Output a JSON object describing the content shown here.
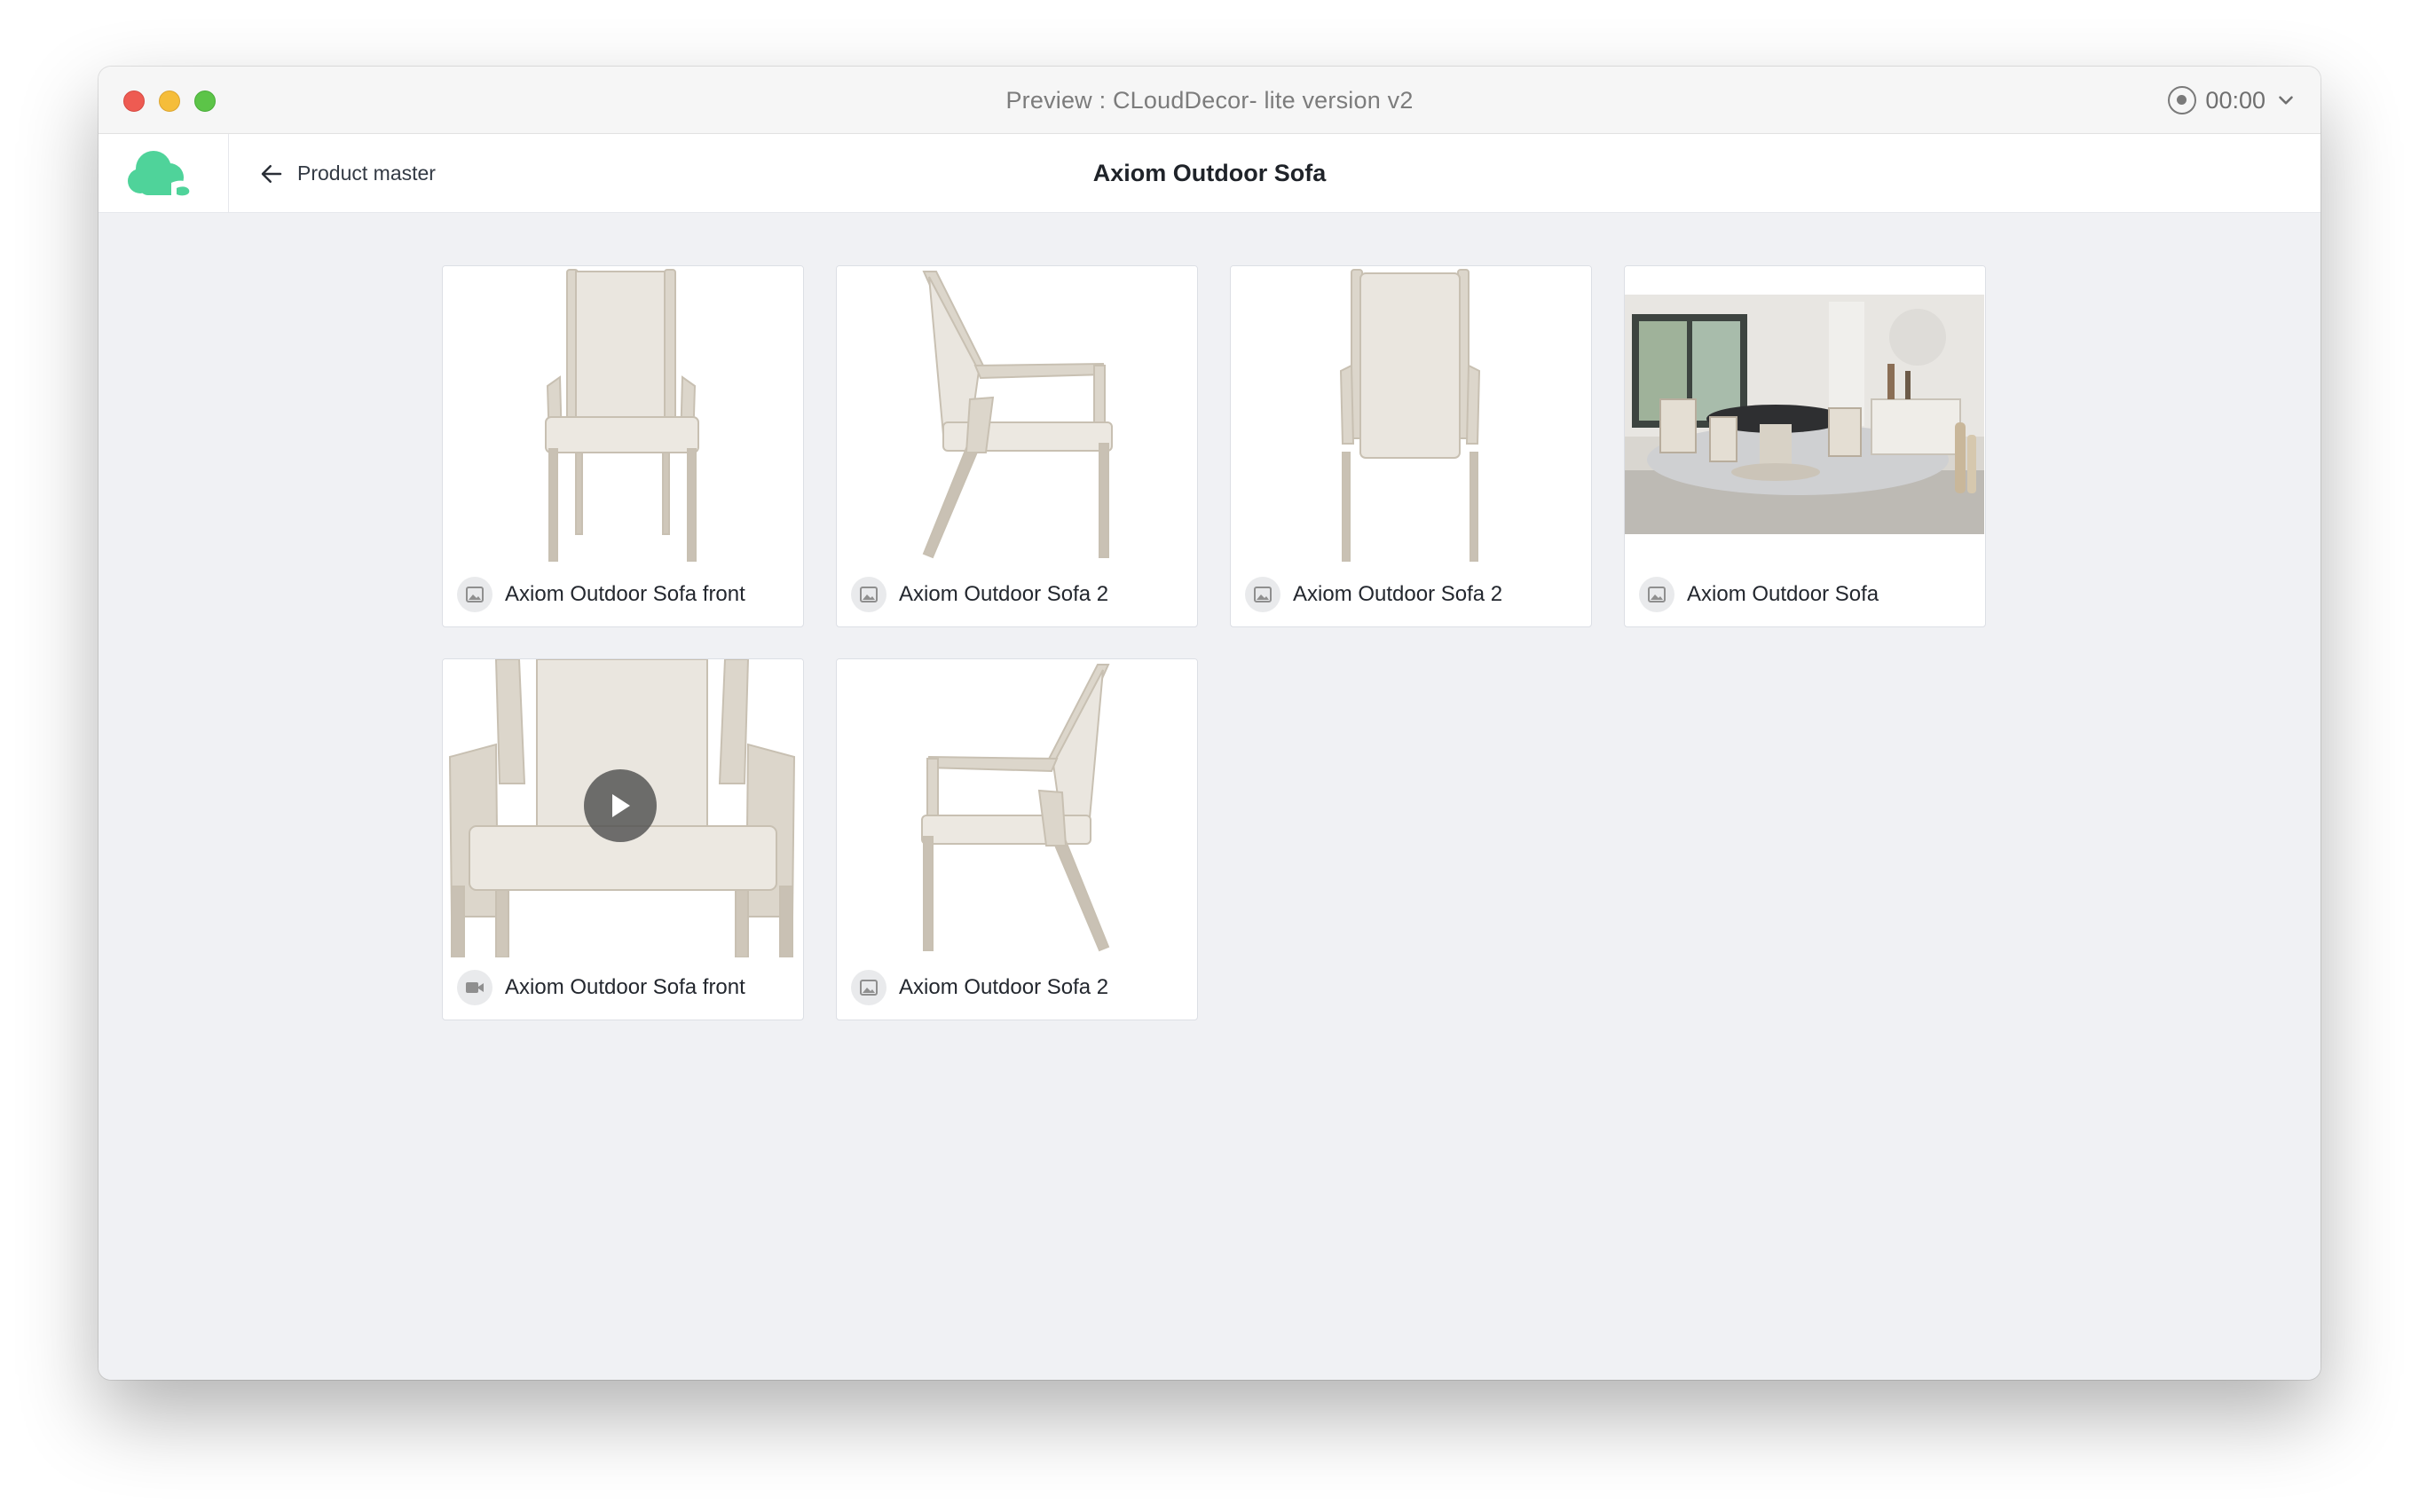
{
  "window": {
    "title": "Preview : CLoudDecor- lite version v2",
    "timer": "00:00"
  },
  "header": {
    "back_label": "Product master",
    "page_title": "Axiom Outdoor Sofa",
    "brand_color": "#4fd39a"
  },
  "gallery": {
    "items": [
      {
        "label": "Axiom Outdoor Sofa front",
        "media_type": "image",
        "view": "chair-front"
      },
      {
        "label": "Axiom Outdoor Sofa 2",
        "media_type": "image",
        "view": "chair-side-right"
      },
      {
        "label": "Axiom Outdoor Sofa 2",
        "media_type": "image",
        "view": "chair-back"
      },
      {
        "label": "Axiom Outdoor Sofa",
        "media_type": "image",
        "view": "dining-room"
      },
      {
        "label": "Axiom Outdoor Sofa front",
        "media_type": "video",
        "view": "chair-closeup"
      },
      {
        "label": "Axiom Outdoor Sofa 2",
        "media_type": "image",
        "view": "chair-side-left"
      }
    ]
  },
  "icons": {
    "image_badge": "image-icon",
    "video_badge": "video-icon",
    "back": "arrow-left-icon",
    "recorder": "record-icon",
    "dropdown": "chevron-down-icon",
    "play": "play-icon"
  }
}
